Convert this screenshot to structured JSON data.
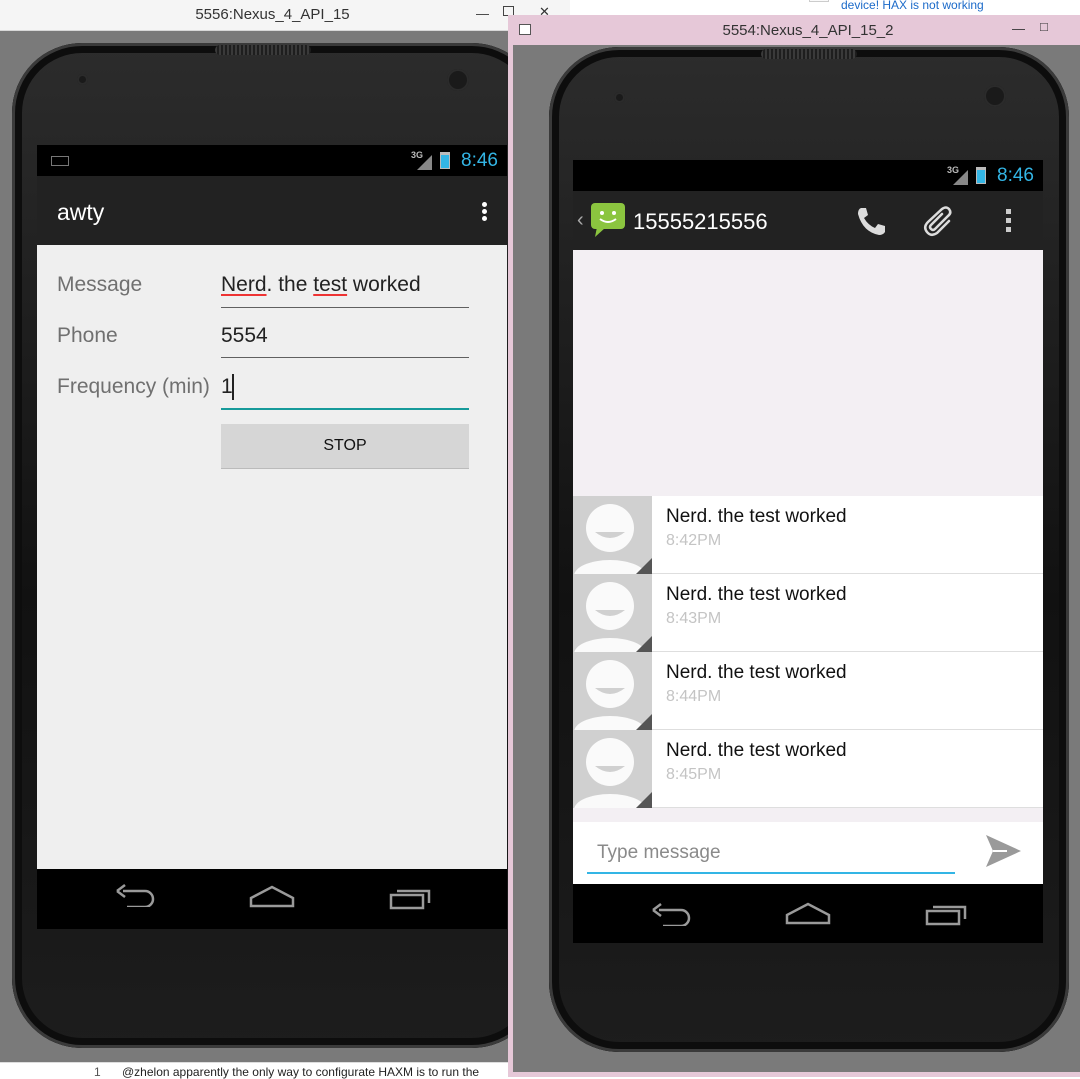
{
  "window_left": {
    "title": "5556:Nexus_4_API_15",
    "buttons": {
      "minimize": "—",
      "close": "✕"
    },
    "status_bar": {
      "network": "3G",
      "time": "8:46"
    },
    "app": {
      "title": "awty",
      "form": {
        "message_label": "Message",
        "message_value_w1": "Nerd",
        "message_value_w2": ". the ",
        "message_value_w3": "test",
        "message_value_w4": " worked",
        "phone_label": "Phone",
        "phone_value": "5554",
        "frequency_label": "Frequency (min)",
        "frequency_value": "1"
      },
      "stop_button": "STOP"
    }
  },
  "window_right": {
    "title": "5554:Nexus_4_API_15_2",
    "buttons": {
      "minimize": "—",
      "maximize": "□"
    },
    "status_bar": {
      "network": "3G",
      "time": "8:46"
    },
    "conversation": {
      "contact": "15555215556",
      "messages": [
        {
          "text": "Nerd. the test worked",
          "time": "8:42PM"
        },
        {
          "text": "Nerd. the test worked",
          "time": "8:43PM"
        },
        {
          "text": "Nerd. the test worked",
          "time": "8:44PM"
        },
        {
          "text": "Nerd. the test worked",
          "time": "8:45PM"
        }
      ],
      "compose_placeholder": "Type message"
    }
  },
  "background_page": {
    "top_link": "device! HAX is not working",
    "comment_number": "1",
    "comment_text": "@zhelon apparently the only way to configurate HAXM is to run the"
  },
  "icons": [
    "keyboard-icon",
    "signal-icon",
    "battery-icon",
    "overflow-menu-icon",
    "back-icon",
    "home-icon",
    "recent-apps-icon",
    "messaging-app-icon",
    "phone-icon",
    "attach-icon",
    "send-icon",
    "avatar-icon"
  ],
  "colors": {
    "accent": "#33b5e5",
    "action_bar": "#222222",
    "window_frame_active": "#e6c8d8"
  }
}
